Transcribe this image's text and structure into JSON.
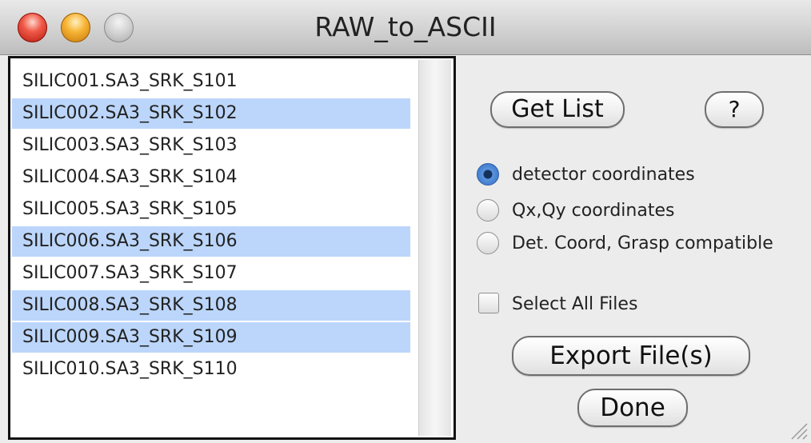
{
  "window": {
    "title": "RAW_to_ASCII"
  },
  "files": [
    {
      "name": "SILIC001.SA3_SRK_S101",
      "selected": false
    },
    {
      "name": "SILIC002.SA3_SRK_S102",
      "selected": true
    },
    {
      "name": "SILIC003.SA3_SRK_S103",
      "selected": false
    },
    {
      "name": "SILIC004.SA3_SRK_S104",
      "selected": false
    },
    {
      "name": "SILIC005.SA3_SRK_S105",
      "selected": false
    },
    {
      "name": "SILIC006.SA3_SRK_S106",
      "selected": true
    },
    {
      "name": "SILIC007.SA3_SRK_S107",
      "selected": false
    },
    {
      "name": "SILIC008.SA3_SRK_S108",
      "selected": true
    },
    {
      "name": "SILIC009.SA3_SRK_S109",
      "selected": true
    },
    {
      "name": "SILIC010.SA3_SRK_S110",
      "selected": false
    }
  ],
  "buttons": {
    "get_list": "Get List",
    "help": "?",
    "export": "Export File(s)",
    "done": "Done"
  },
  "coordinates": {
    "options": [
      "detector coordinates",
      "Qx,Qy coordinates",
      "Det. Coord, Grasp compatible"
    ],
    "selected": "detector coordinates"
  },
  "select_all": {
    "label": "Select All Files",
    "checked": false
  },
  "colors": {
    "selection": "#bcd6fb",
    "radio_selected": "#2f6cc4"
  }
}
